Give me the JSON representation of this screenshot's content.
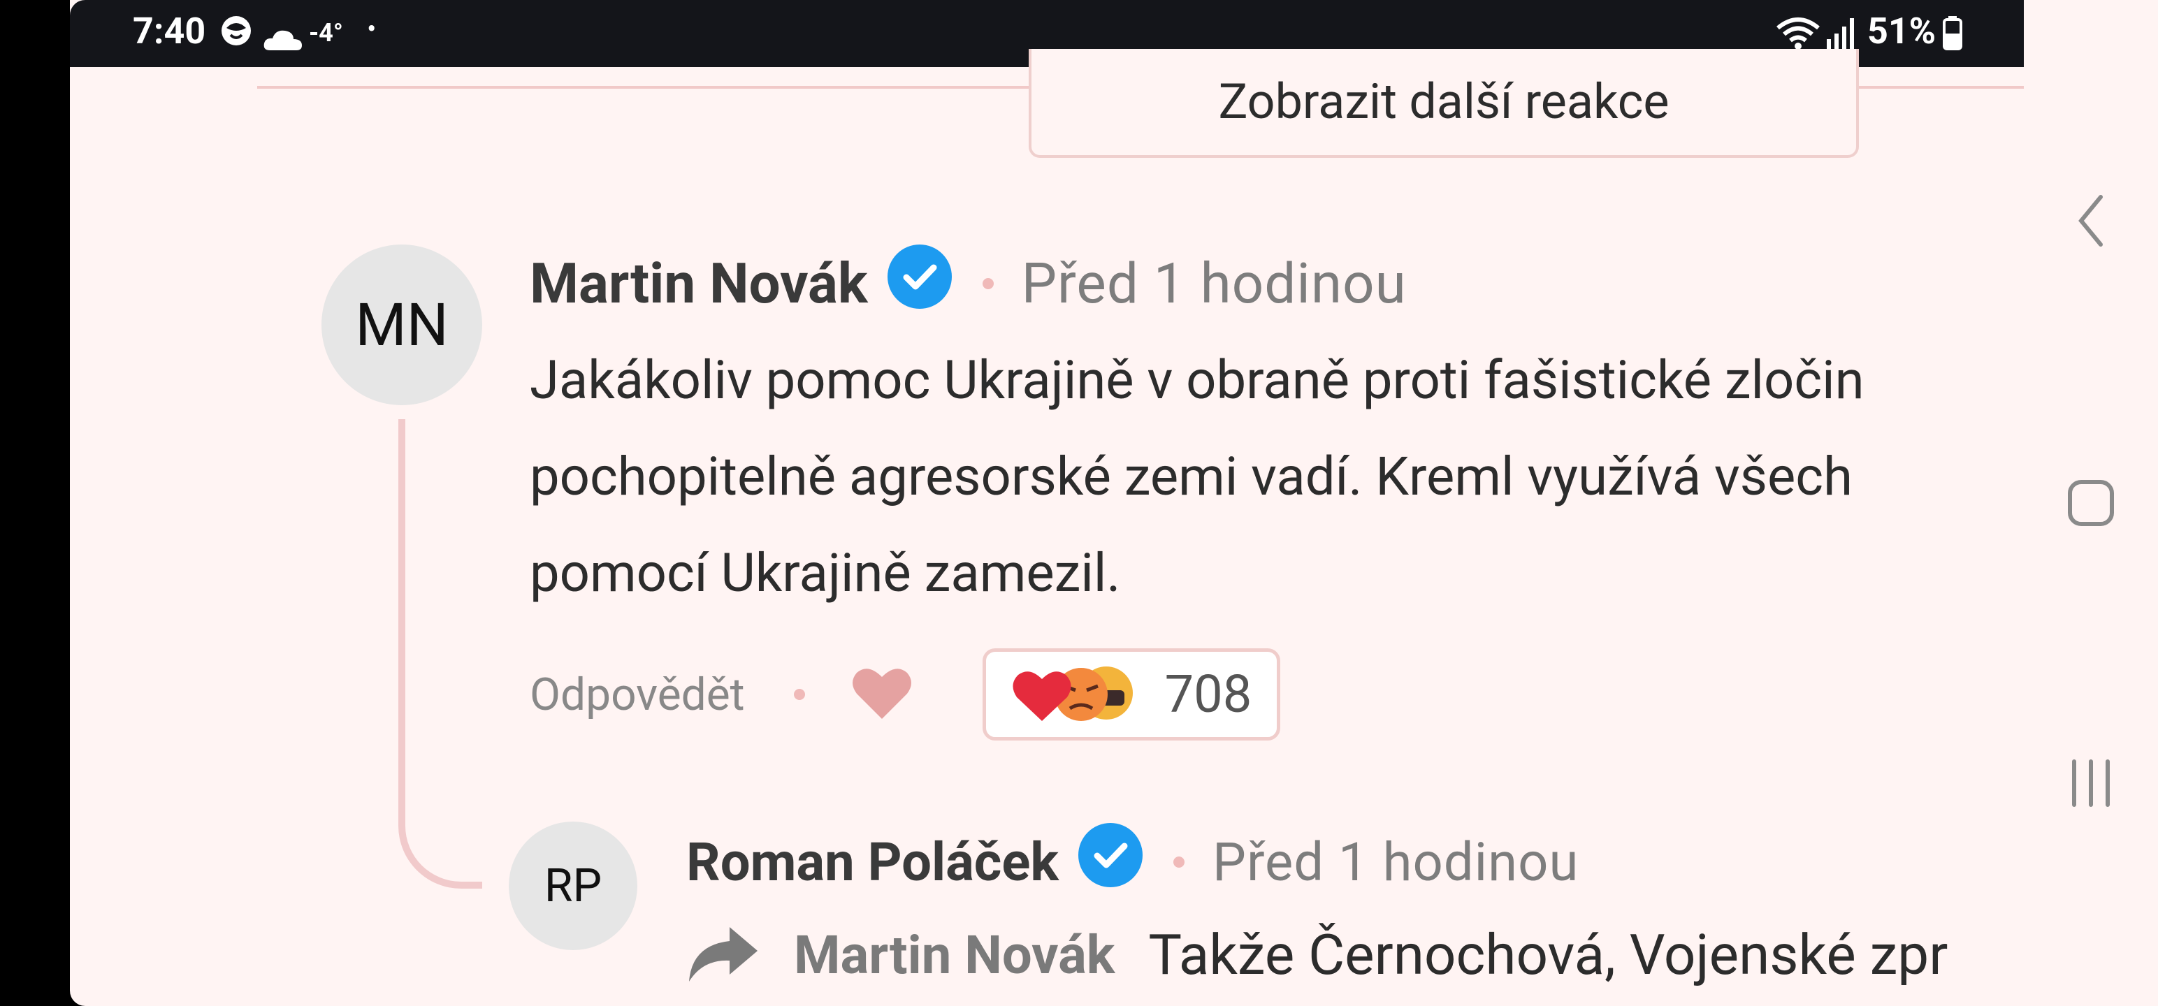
{
  "status_bar": {
    "time": "7:40",
    "temperature": "-4°",
    "notification_dot": "•",
    "battery": "51%"
  },
  "thread": {
    "show_more_label": "Zobrazit další reakce"
  },
  "comment": {
    "avatar_initials": "MN",
    "author": "Martin Novák",
    "time": "Před 1 hodinou",
    "text_lines": [
      "Jakákoliv pomoc Ukrajině v obraně proti fašistické zločin",
      "pochopitelně agresorské zemi vadí. Kreml využívá všech",
      "pomocí Ukrajině zamezil."
    ],
    "reply_label": "Odpovědět",
    "reaction_count": "708"
  },
  "reply": {
    "avatar_initials": "RP",
    "author": "Roman Poláček",
    "time": "Před 1 hodinou",
    "replying_to": "Martin Novák",
    "text": "Takže Černochová, Vojenské zpr"
  },
  "colors": {
    "background": "#fff4f3",
    "verified": "#1d9bf0",
    "accent_line": "#f1cacb",
    "like_heart": "#e5a2a1"
  },
  "icons": [
    "mascot-icon",
    "cloud-icon",
    "wifi-icon",
    "signal-icon",
    "battery-icon",
    "verified-icon",
    "heart-icon",
    "reply-arrow-icon",
    "back-icon",
    "home-icon",
    "recents-icon"
  ]
}
